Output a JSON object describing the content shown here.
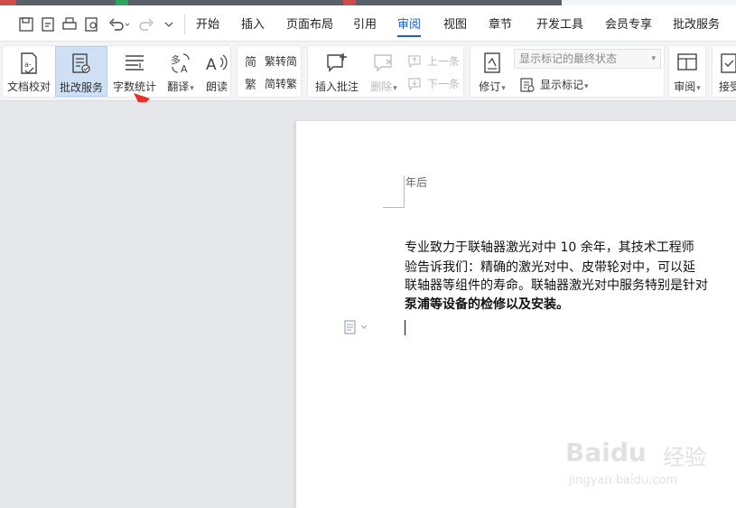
{
  "menu": {
    "tabs": [
      "开始",
      "插入",
      "页面布局",
      "引用",
      "审阅",
      "视图",
      "章节",
      "开发工具",
      "会员专享",
      "批改服务"
    ],
    "active": "审阅"
  },
  "ribbon": {
    "proofread": "文档校对",
    "correction_service": "批改服务",
    "word_count": "字数统计",
    "translate": "翻译",
    "read_aloud": "朗读",
    "trad_to_simp": "繁转简",
    "simp_to_trad": "简转繁",
    "insert_comment": "插入批注",
    "delete": "删除",
    "prev": "上一条",
    "next": "下一条",
    "track_changes": "修订",
    "display_mode": "显示标记的最终状态",
    "show_markup": "显示标记",
    "review": "审阅",
    "accept": "接受"
  },
  "document": {
    "header_fragment": "年后",
    "lines": [
      "专业致力于联轴器激光对中 10 余年，其技术工程师",
      "验告诉我们：精确的激光对中、皮带轮对中，可以延",
      "联轴器等组件的寿命。联轴器激光对中服务特别是针对",
      "泵浦等设备的检修以及安装。"
    ]
  },
  "watermark": {
    "brand": "Baidu",
    "brand_cn": "经验",
    "url": "jingyan.baidu.com"
  },
  "colors": {
    "accent": "#1f5fbf",
    "selected_button_bg": "#cfe0f5",
    "annotation_arrow": "#e8302a"
  }
}
